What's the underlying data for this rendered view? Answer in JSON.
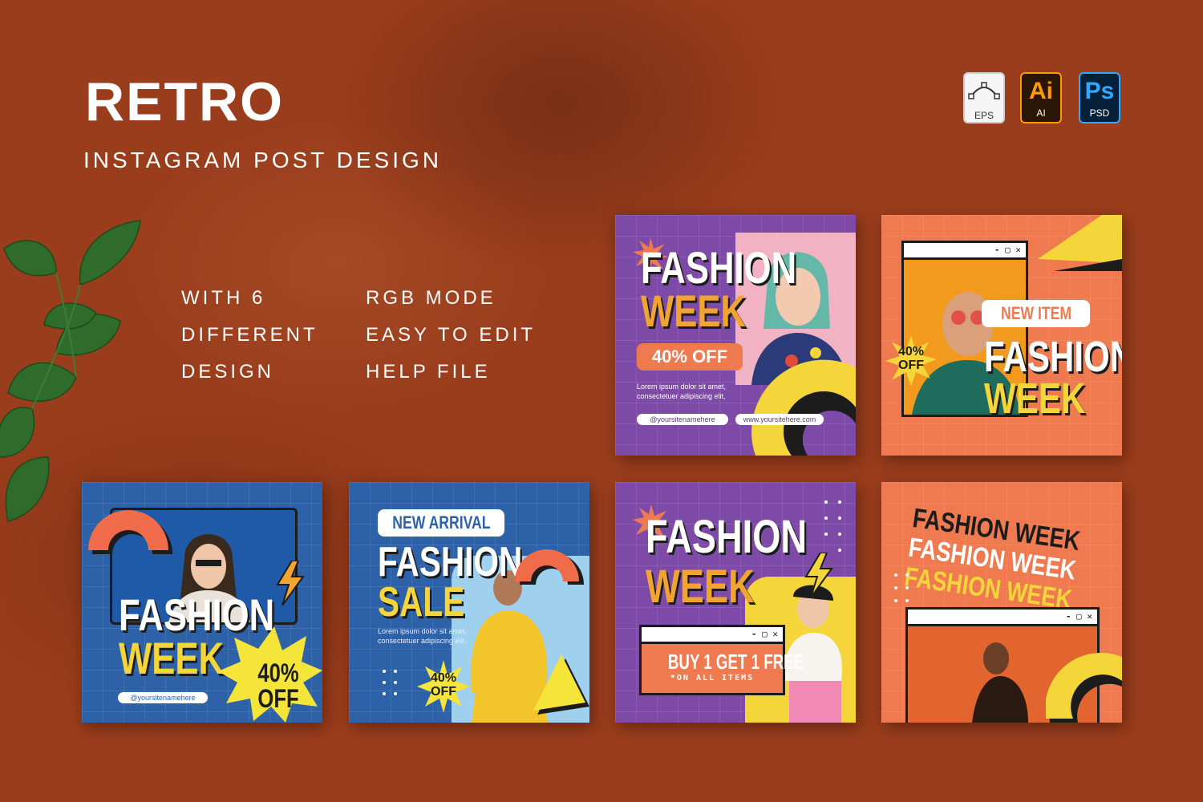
{
  "header": {
    "title": "RETRO",
    "subtitle": "INSTAGRAM POST DESIGN"
  },
  "features": {
    "col1": [
      "WITH 6",
      "DIFFERENT",
      "DESIGN"
    ],
    "col2": [
      "RGB MODE",
      "EASY TO EDIT",
      "HELP FILE"
    ]
  },
  "file_types": [
    {
      "mark": "",
      "label": "EPS",
      "icon": "vector-pen-icon"
    },
    {
      "mark": "Ai",
      "label": "AI",
      "icon": "illustrator-icon"
    },
    {
      "mark": "Ps",
      "label": "PSD",
      "icon": "photoshop-icon"
    }
  ],
  "window_controls": "- ▢ ✕",
  "posts": [
    {
      "line1": "FASHION",
      "line2": "WEEK",
      "badge": "40% OFF",
      "lorem": "Lorem ipsum dolor sit amet, consectetuer adipiscing elit,",
      "handle": "@yoursitenamehere",
      "website": "www.yoursitehere.com"
    },
    {
      "tag": "NEW ITEM",
      "line1": "FASHION",
      "line2": "WEEK",
      "badge_top": "40%",
      "badge_bottom": "OFF"
    },
    {
      "line1": "FASHION",
      "line2": "WEEK",
      "badge_top": "40%",
      "badge_bottom": "OFF",
      "handle": "@yoursitenamehere"
    },
    {
      "tag": "NEW ARRIVAL",
      "line1": "FASHION",
      "line2": "SALE",
      "lorem": "Lorem ipsum dolor sit amet, consectetuer adipiscing elit.",
      "badge_top": "40%",
      "badge_bottom": "OFF"
    },
    {
      "line1": "FASHION",
      "line2": "WEEK",
      "offer": "BUY 1 GET 1 FREE",
      "offer_note": "*ON ALL ITEMS"
    },
    {
      "rows": [
        {
          "a": "FASHION",
          "b": "WEEK"
        },
        {
          "a": "FASHION",
          "b": "WEEK"
        },
        {
          "a": "FASHION",
          "b": "WEEK"
        }
      ]
    }
  ],
  "colors": {
    "background": "#9a3d1c",
    "purple": "#7d4aa8",
    "orange": "#ef7a4f",
    "blue": "#2d62a8",
    "yellow": "#f5d63a",
    "ink": "#1c1c1c"
  }
}
